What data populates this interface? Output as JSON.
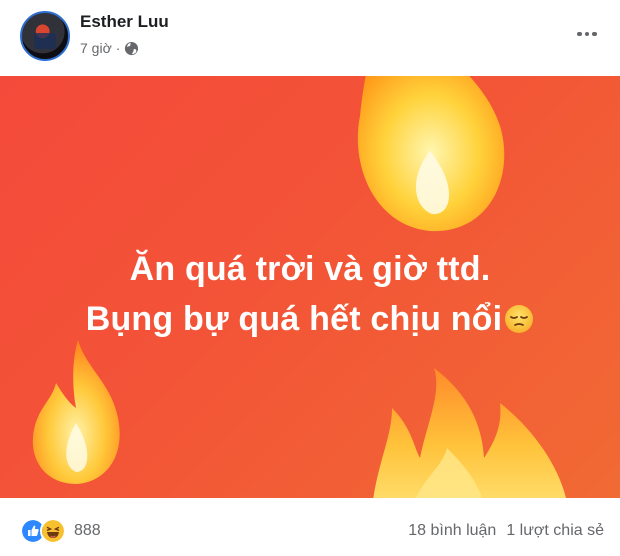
{
  "post": {
    "author": "Esther Luu",
    "time": "7 giờ",
    "separator": "·",
    "privacy_icon": "globe-icon",
    "text_line1": "Ăn quá trời và giờ ttd.",
    "text_line2": "Bụng bự quá hết chịu nổi",
    "emoji": "sad-face-icon",
    "background_colors": [
      "#f44a3b",
      "#f16a34"
    ]
  },
  "footer": {
    "reaction_icons": [
      "like-icon",
      "haha-icon"
    ],
    "reaction_count": "888",
    "comments": "18 bình luận",
    "shares": "1 lượt chia sẻ"
  }
}
